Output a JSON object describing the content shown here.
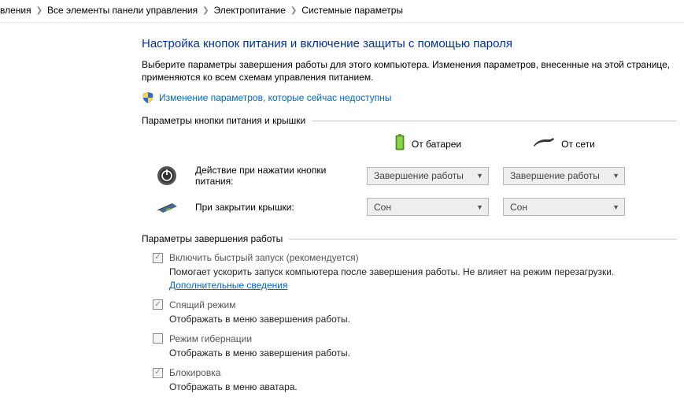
{
  "breadcrumb": {
    "item0": "вления",
    "item1": "Все элементы панели управления",
    "item2": "Электропитание",
    "item3": "Системные параметры"
  },
  "header": {
    "title": "Настройка кнопок питания и включение защиты с помощью пароля",
    "subtitle": "Выберите параметры завершения работы для этого компьютера. Изменения параметров, внесенные на этой странице, применяются ко всем схемам управления питанием.",
    "admin_link": "Изменение параметров, которые сейчас недоступны"
  },
  "sections": {
    "power_lid_title": "Параметры кнопки питания и крышки",
    "shutdown_title": "Параметры завершения работы"
  },
  "power_grid": {
    "col_battery": "От батареи",
    "col_ac": "От сети",
    "row_power_btn": "Действие при нажатии кнопки питания:",
    "row_lid": "При закрытии крышки:",
    "val_shutdown": "Завершение работы",
    "val_sleep": "Сон"
  },
  "checkboxes": [
    {
      "label": "Включить быстрый запуск (рекомендуется)",
      "desc_pre": "Помогает ускорить запуск компьютера после завершения работы. Не влияет на режим перезагрузки. ",
      "desc_link": "Дополнительные сведения",
      "checked": true
    },
    {
      "label": "Спящий режим",
      "desc": "Отображать в меню завершения работы.",
      "checked": true
    },
    {
      "label": "Режим гибернации",
      "desc": "Отображать в меню завершения работы.",
      "checked": false
    },
    {
      "label": "Блокировка",
      "desc": "Отображать в меню аватара.",
      "checked": true
    }
  ]
}
